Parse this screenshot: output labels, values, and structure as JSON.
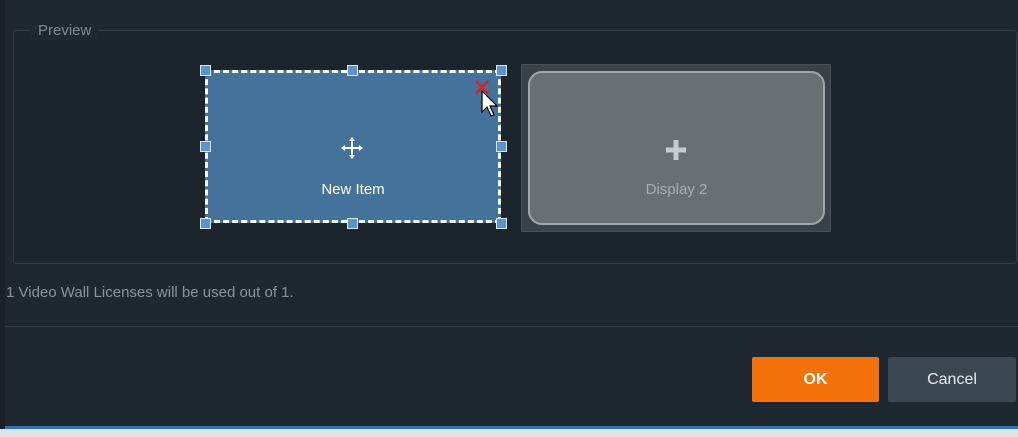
{
  "preview": {
    "legend": "Preview",
    "new_item": {
      "label": "New Item",
      "icon": "move-icon",
      "color": "#45729a"
    },
    "display_2": {
      "label": "Display 2",
      "icon": "plus-icon",
      "color": "#6a6f73"
    }
  },
  "license_text": "1 Video Wall Licenses will be used out of 1.",
  "buttons": {
    "ok_label": "OK",
    "cancel_label": "Cancel"
  },
  "colors": {
    "accent": "#f5720a",
    "background": "#1f2830",
    "selection": "#5b93cf"
  }
}
